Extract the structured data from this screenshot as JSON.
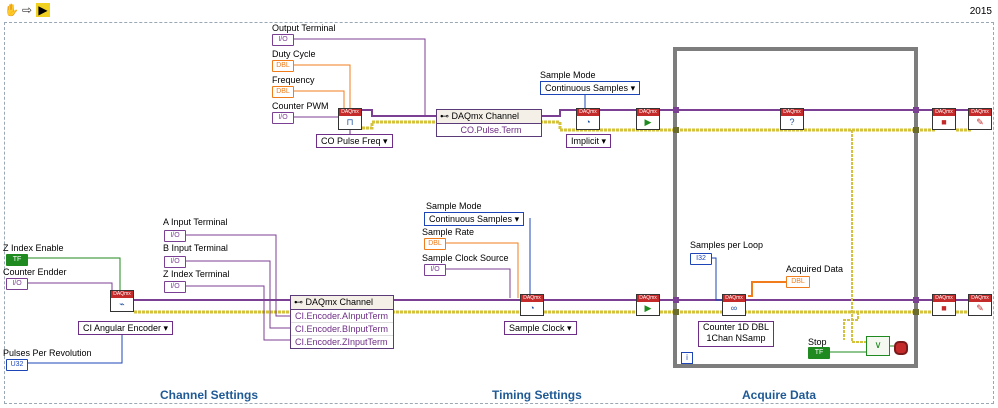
{
  "toolbar": {
    "version": "2015"
  },
  "labels": {
    "output_terminal": "Output Terminal",
    "duty_cycle": "Duty Cycle",
    "frequency": "Frequency",
    "counter_pwm": "Counter PWM",
    "sample_mode_top": "Sample Mode",
    "z_index_enable": "Z Index Enable",
    "counter_endder": "Counter Endder",
    "a_input_terminal": "A Input Terminal",
    "b_input_terminal": "B Input Terminal",
    "z_index_terminal": "Z Index Terminal",
    "pulses_per_revolution": "Pulses Per Revolution",
    "sample_mode_mid": "Sample Mode",
    "sample_rate": "Sample Rate",
    "sample_clock_source": "Sample Clock Source",
    "samples_per_loop": "Samples per Loop",
    "acquired_data": "Acquired Data",
    "stop": "Stop"
  },
  "terminals": {
    "io": "I/O",
    "dbl": "DBL",
    "tf": "TF",
    "u32": "U32",
    "i32": "I32"
  },
  "rings": {
    "co_pulse_freq": "CO Pulse Freq",
    "continuous_samples_top": "Continuous Samples",
    "implicit": "Implicit",
    "ci_angular_encoder": "CI Angular Encoder",
    "continuous_samples_mid": "Continuous Samples",
    "sample_clock": "Sample Clock",
    "counter_1d_dbl": "Counter 1D DBL",
    "one_chan_nsamp": "1Chan NSamp"
  },
  "property_nodes": {
    "top": {
      "header": "DAQmx Channel",
      "rows": [
        "CO.Pulse.Term"
      ]
    },
    "bottom": {
      "header": "DAQmx Channel",
      "rows": [
        "CI.Encoder.AInputTerm",
        "CI.Encoder.BInputTerm",
        "CI.Encoder.ZInputTerm"
      ]
    }
  },
  "node_header": "DAQmx",
  "loop_index": "i",
  "sections": {
    "channel_settings": "Channel Settings",
    "timing_settings": "Timing Settings",
    "acquire_data": "Acquire Data"
  },
  "colors": {
    "refnum_wire": "#7b3f94",
    "error_wire": "#d4c23a",
    "dbl_wire": "#f07c1c",
    "int_wire": "#1d45b8",
    "bool_wire": "#1f8a1f",
    "section_text": "#1f5a96",
    "loop_border": "#7d7d7d"
  }
}
